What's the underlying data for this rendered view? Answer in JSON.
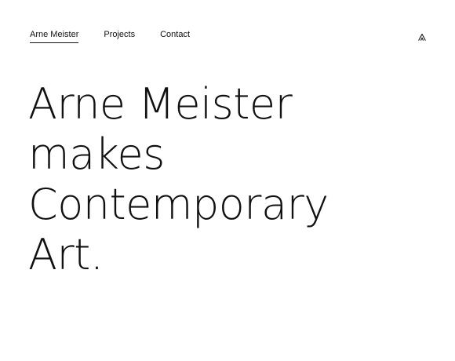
{
  "nav": {
    "items": [
      {
        "label": "Arne Meister",
        "active": true
      },
      {
        "label": "Projects",
        "active": false
      },
      {
        "label": "Contact",
        "active": false
      }
    ]
  },
  "logo": {
    "icon": "monogram-icon"
  },
  "hero": {
    "lines": [
      "Arne Meister",
      "makes",
      "Contemporary",
      "Art."
    ]
  },
  "colors": {
    "text": "#111111",
    "background": "#ffffff"
  }
}
